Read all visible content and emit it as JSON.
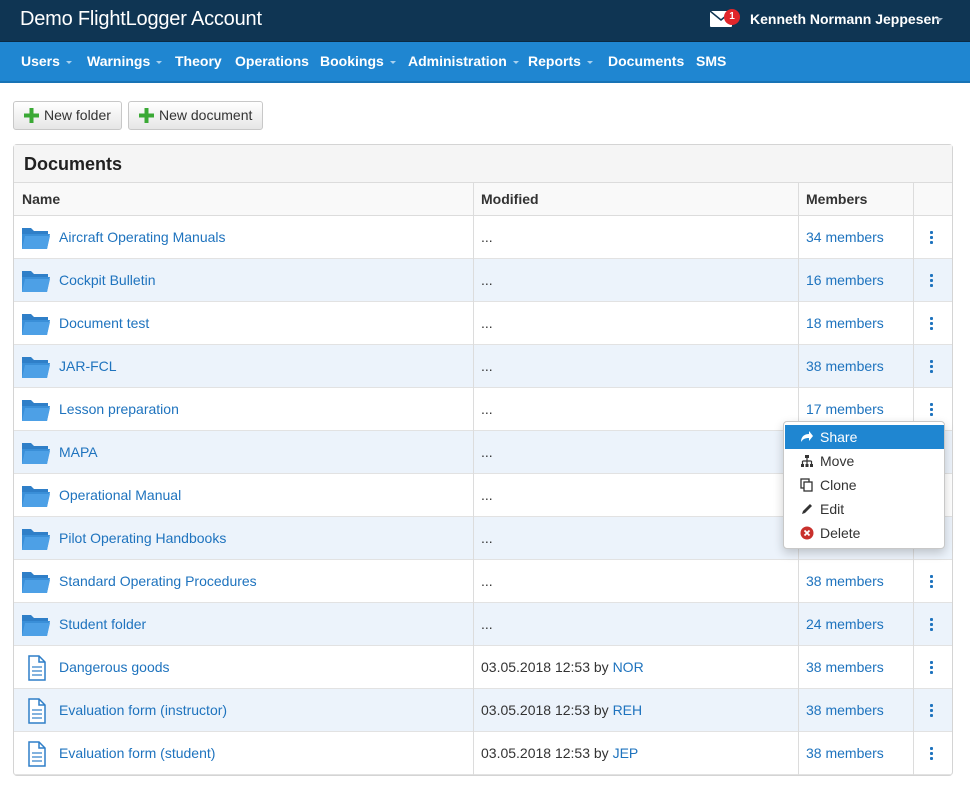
{
  "header": {
    "app_title": "Demo FlightLogger Account",
    "mail_count": "1",
    "user_name": "Kenneth Normann Jeppesen"
  },
  "nav": [
    {
      "label": "Users",
      "has_caret": true
    },
    {
      "label": "Warnings",
      "has_caret": true
    },
    {
      "label": "Theory",
      "has_caret": false
    },
    {
      "label": "Operations",
      "has_caret": false
    },
    {
      "label": "Bookings",
      "has_caret": true
    },
    {
      "label": "Administration",
      "has_caret": true
    },
    {
      "label": "Reports",
      "has_caret": true
    },
    {
      "label": "Documents",
      "has_caret": false
    },
    {
      "label": "SMS",
      "has_caret": false
    }
  ],
  "toolbar": {
    "new_folder": "New folder",
    "new_document": "New document"
  },
  "documents": {
    "title": "Documents",
    "columns": {
      "name": "Name",
      "modified": "Modified",
      "members": "Members"
    },
    "rows": [
      {
        "type": "folder",
        "name": "Aircraft Operating Manuals",
        "modified": "...",
        "by": "",
        "members": "34 members"
      },
      {
        "type": "folder",
        "name": "Cockpit Bulletin",
        "modified": "...",
        "by": "",
        "members": "16 members"
      },
      {
        "type": "folder",
        "name": "Document test",
        "modified": "...",
        "by": "",
        "members": "18 members"
      },
      {
        "type": "folder",
        "name": "JAR-FCL",
        "modified": "...",
        "by": "",
        "members": "38 members"
      },
      {
        "type": "folder",
        "name": "Lesson preparation",
        "modified": "...",
        "by": "",
        "members": "17 members"
      },
      {
        "type": "folder",
        "name": "MAPA",
        "modified": "...",
        "by": "",
        "members": ""
      },
      {
        "type": "folder",
        "name": "Operational Manual",
        "modified": "...",
        "by": "",
        "members": ""
      },
      {
        "type": "folder",
        "name": "Pilot Operating Handbooks",
        "modified": "...",
        "by": "",
        "members": ""
      },
      {
        "type": "folder",
        "name": "Standard Operating Procedures",
        "modified": "...",
        "by": "",
        "members": "38 members"
      },
      {
        "type": "folder",
        "name": "Student folder",
        "modified": "...",
        "by": "",
        "members": "24 members"
      },
      {
        "type": "file",
        "name": "Dangerous goods",
        "modified": "03.05.2018 12:53 by ",
        "by": "NOR",
        "members": "38 members"
      },
      {
        "type": "file",
        "name": "Evaluation form (instructor)",
        "modified": "03.05.2018 12:53 by ",
        "by": "REH",
        "members": "38 members"
      },
      {
        "type": "file",
        "name": "Evaluation form (student)",
        "modified": "03.05.2018 12:53 by ",
        "by": "JEP",
        "members": "38 members"
      }
    ]
  },
  "context_menu": {
    "items": [
      {
        "label": "Share",
        "icon": "share-icon",
        "active": true
      },
      {
        "label": "Move",
        "icon": "sitemap-icon",
        "active": false
      },
      {
        "label": "Clone",
        "icon": "clone-icon",
        "active": false
      },
      {
        "label": "Edit",
        "icon": "pencil-icon",
        "active": false
      },
      {
        "label": "Delete",
        "icon": "delete-icon",
        "active": false
      }
    ]
  },
  "colors": {
    "topbar": "#0f3553",
    "navbar": "#1f86d1",
    "link": "#1e73be",
    "row_alt": "#ecf3fb",
    "badge": "#e0262b",
    "plus": "#3aa935"
  }
}
